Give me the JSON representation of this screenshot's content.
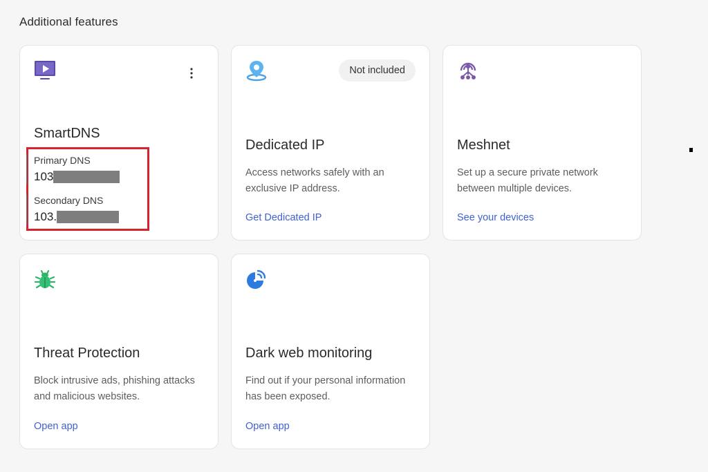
{
  "section_title": "Additional features",
  "cards": {
    "smartdns": {
      "title": "SmartDNS",
      "primary_label": "Primary DNS",
      "primary_value": "103",
      "secondary_label": "Secondary DNS",
      "secondary_value": "103."
    },
    "dedicated_ip": {
      "badge": "Not included",
      "title": "Dedicated IP",
      "desc": "Access networks safely with an exclusive IP address.",
      "link": "Get Dedicated IP"
    },
    "meshnet": {
      "title": "Meshnet",
      "desc": "Set up a secure private network between multiple devices.",
      "link": "See your devices"
    },
    "threat_protection": {
      "title": "Threat Protection",
      "desc": "Block intrusive ads, phishing attacks and malicious websites.",
      "link": "Open app"
    },
    "dark_web": {
      "title": "Dark web monitoring",
      "desc": "Find out if your personal information has been exposed.",
      "link": "Open app"
    }
  },
  "icons": {
    "smartdns": "tv-play-icon",
    "dedicated_ip": "location-pin-icon",
    "meshnet": "mesh-network-icon",
    "threat_protection": "bug-icon",
    "dark_web": "radar-icon",
    "menu": "more-vertical-icon"
  },
  "colors": {
    "link": "#3e5fd6",
    "highlight_box": "#d9212e",
    "smartdns_icon": "#5b4aa8",
    "dedicated_ip_icon": "#4aa3e8",
    "meshnet_icon": "#7a5aa8",
    "threat_icon": "#2fb36a",
    "dark_web_icon": "#2d7be0"
  }
}
